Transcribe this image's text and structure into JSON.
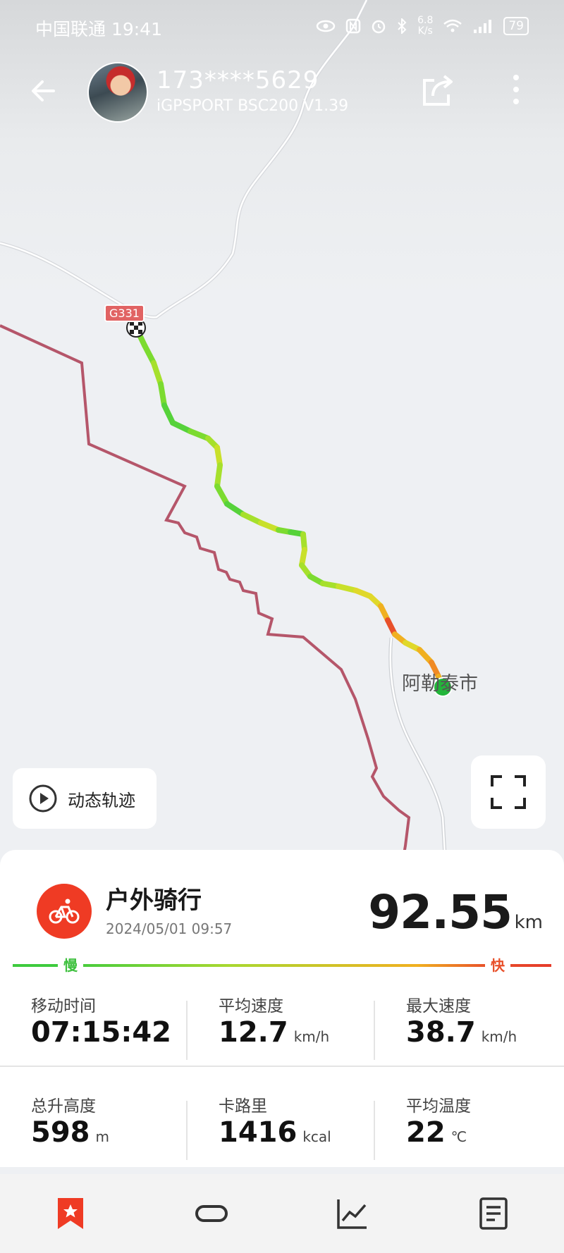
{
  "status_bar": {
    "carrier_time": "中国联通 19:41",
    "net_speed_value": "6.8",
    "net_speed_unit": "K/s",
    "battery": "79",
    "icons": [
      "eye-icon",
      "nfc-icon",
      "alarm-icon",
      "bluetooth-icon",
      "wifi-icon",
      "signal-icon",
      "battery-icon"
    ]
  },
  "header": {
    "user_id": "173****5629",
    "device": "iGPSPORT BSC200  V1.39",
    "icons": [
      "back-arrow-icon",
      "share-icon",
      "more-vertical-icon"
    ]
  },
  "map": {
    "road_badge": "G331",
    "city_label": "阿勒泰市",
    "replay_label": "动态轨迹",
    "colors": {
      "route_slow": "#3ecb3e",
      "route_mid": "#c9e02a",
      "route_fast": "#e8502a",
      "border": "#b5566a",
      "road": "#ffffff"
    }
  },
  "activity": {
    "sport_name": "户外骑行",
    "date": "2024/05/01 09:57",
    "distance": "92.55",
    "distance_unit": "km",
    "legend_slow": "慢",
    "legend_fast": "快",
    "stats": [
      {
        "label": "移动时间",
        "value": "07:15:42",
        "unit": ""
      },
      {
        "label": "平均速度",
        "value": "12.7",
        "unit": "km/h"
      },
      {
        "label": "最大速度",
        "value": "38.7",
        "unit": "km/h"
      },
      {
        "label": "总升高度",
        "value": "598",
        "unit": "m"
      },
      {
        "label": "卡路里",
        "value": "1416",
        "unit": "kcal"
      },
      {
        "label": "平均温度",
        "value": "22",
        "unit": "℃"
      }
    ]
  },
  "bottom_nav": {
    "items": [
      "bookmark-star-icon",
      "loop-icon",
      "line-chart-icon",
      "document-list-icon"
    ],
    "active_color": "#ef3b24"
  }
}
